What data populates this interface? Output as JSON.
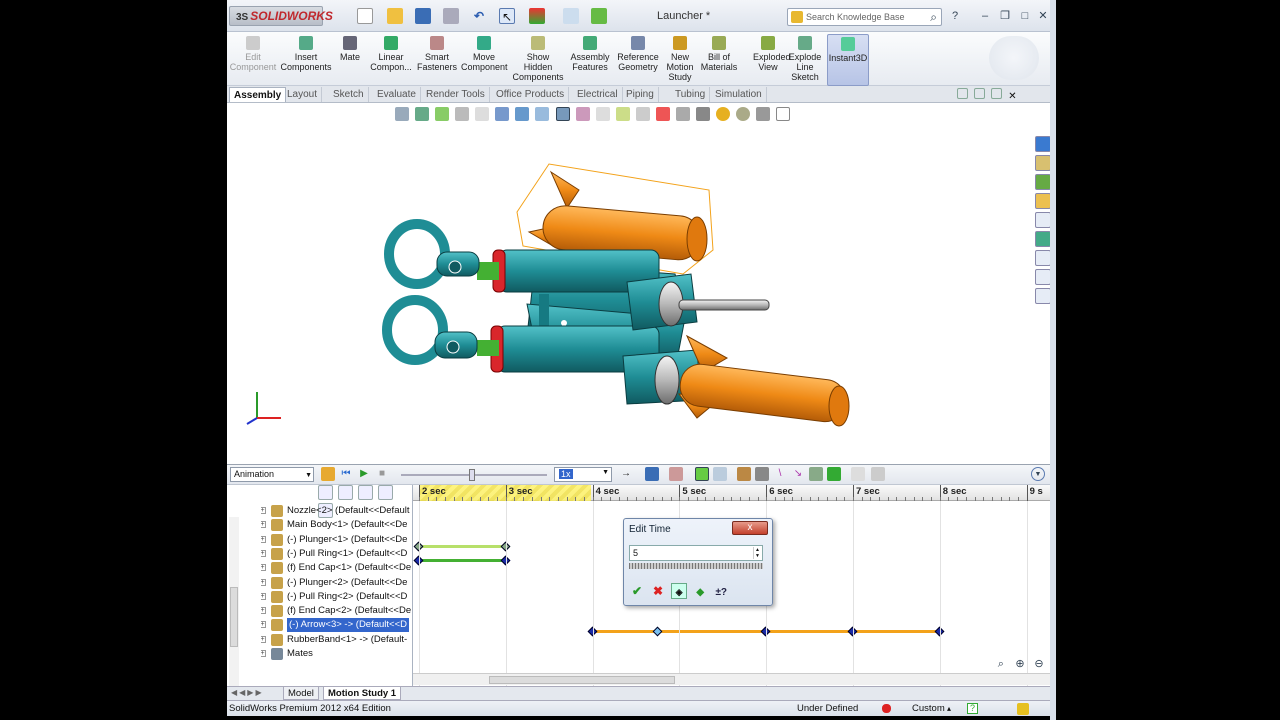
{
  "titlebar": {
    "brand": "SOLIDWORKS",
    "brand_prefix": "3S",
    "document": "Launcher *",
    "search_placeholder": "Search Knowledge Base",
    "help": "?"
  },
  "ribbon": [
    {
      "label": "Edit\nComponent",
      "disabled": true
    },
    {
      "label": "Insert\nComponents"
    },
    {
      "label": "Mate"
    },
    {
      "label": "Linear\nCompon..."
    },
    {
      "label": "Smart\nFasteners"
    },
    {
      "label": "Move\nComponent"
    },
    {
      "label": "Show\nHidden\nComponents"
    },
    {
      "label": "Assembly\nFeatures"
    },
    {
      "label": "Reference\nGeometry"
    },
    {
      "label": "New\nMotion\nStudy"
    },
    {
      "label": "Bill of\nMaterials"
    },
    {
      "label": "Exploded\nView"
    },
    {
      "label": "Explode\nLine\nSketch"
    },
    {
      "label": "Instant3D",
      "active": true
    }
  ],
  "tabs": [
    "Assembly",
    "Layout",
    "Sketch",
    "Evaluate",
    "Render Tools",
    "Office Products",
    "Electrical",
    "Piping",
    "Tubing",
    "Simulation"
  ],
  "motion": {
    "study_type": "Animation",
    "speed": "1x",
    "ticks": [
      "2 sec",
      "3 sec",
      "4 sec",
      "5 sec",
      "6 sec",
      "7 sec",
      "8 sec",
      "9 s"
    ]
  },
  "tree": [
    "Nozzle<2> (Default<<Default",
    "Main Body<1> (Default<<De",
    "(-) Plunger<1> (Default<<De",
    "(-) Pull Ring<1> (Default<<D",
    "(f) End Cap<1> (Default<<De",
    "(-) Plunger<2> (Default<<De",
    "(-) Pull Ring<2> (Default<<D",
    "(f) End Cap<2> (Default<<De",
    "(-) Arrow<3> -> (Default<<D",
    "RubberBand<1> -> (Default-",
    "Mates"
  ],
  "edit_time": {
    "title": "Edit Time",
    "value": "5",
    "close": "x"
  },
  "bottom_tabs": [
    "Model",
    "Motion Study 1"
  ],
  "status": {
    "edition": "SolidWorks Premium 2012 x64 Edition",
    "state": "Under Defined",
    "units": "Custom"
  },
  "colors": {
    "teal": "#1f8d95",
    "orange": "#ef8a16",
    "red": "#d9262b",
    "key_blue": "#1a2aa8",
    "bar_green": "#44b033",
    "bar_orange": "#f3a21a"
  }
}
